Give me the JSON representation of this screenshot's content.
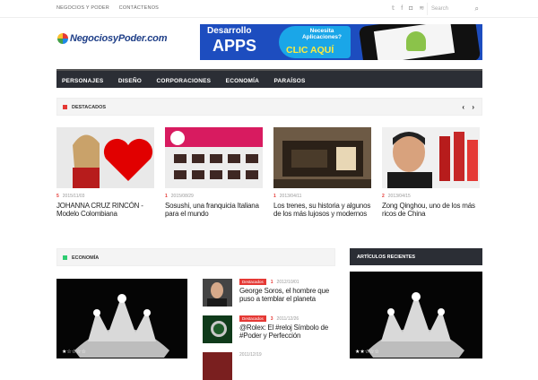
{
  "topbar": {
    "links": [
      "NEGOCIOS Y PODER",
      "CONTÁCTENOS"
    ],
    "search_placeholder": "Search"
  },
  "logo": {
    "text": "NegociosyPoder.com"
  },
  "banner": {
    "left_line1": "Desarrollo",
    "left_line2": "APPS",
    "pill_line1": "Necesita Aplicaciones?",
    "cta": "CLIC AQUÍ"
  },
  "nav": {
    "items": [
      "PERSONAJES",
      "DISEÑO",
      "CORPORACIONES",
      "ECONOMÍA",
      "PARAÍSOS"
    ]
  },
  "destacados": {
    "title": "DESTACADOS",
    "color": "#e53935",
    "cards": [
      {
        "comments": "5",
        "date": "2015/11/03",
        "title": "JOHANNA CRUZ RINCÓN - Modelo Colombiana"
      },
      {
        "comments": "1",
        "date": "2015/08/29",
        "title": "Sosushi, una franquicia Italiana para el mundo"
      },
      {
        "comments": "1",
        "date": "2013/04/11",
        "title": "Los trenes, su historia y algunos de los más lujosos y modernos"
      },
      {
        "comments": "2",
        "date": "2013/04/15",
        "title": "Zong Qinghou, uno de los más ricos de China"
      }
    ]
  },
  "economia": {
    "title": "ECONOMÍA",
    "color": "#2ecc71",
    "items": [
      {
        "badge": "Destacados",
        "comments": "1",
        "date": "2012/10/01",
        "title": "George Soros, el hombre que puso a temblar el planeta"
      },
      {
        "badge": "Destacados",
        "comments": "3",
        "date": "2011/12/26",
        "title": "@Rolex: El #reloj Símbolo de #Poder y Perfección"
      },
      {
        "badge": "",
        "comments": "",
        "date": "2011/12/19",
        "title": ""
      }
    ],
    "big_stars": "★☆☆☆☆"
  },
  "sidebar": {
    "title": "ARTÍCULOS RECIENTES",
    "stars": "★★☆☆☆"
  }
}
